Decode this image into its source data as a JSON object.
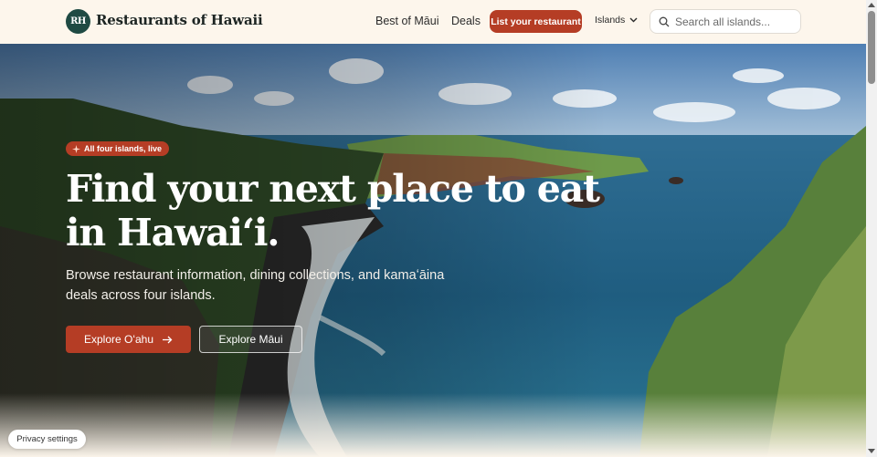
{
  "brand": {
    "mark": "RH",
    "name": "Restaurants of Hawaii"
  },
  "nav": {
    "best_of": "Best of Māui",
    "deals": "Deals",
    "list_restaurant": "List your restaurant",
    "islands": "Islands"
  },
  "search": {
    "placeholder": "Search all islands..."
  },
  "hero": {
    "badge": "All four islands, live",
    "headline": "Find your next place to eat in Hawaiʻi.",
    "subtext": "Browse restaurant information, dining collections, and kamaʻāina deals across four islands.",
    "primary_cta": "Explore Oʻahu",
    "secondary_cta": "Explore Māui"
  },
  "privacy": "Privacy settings",
  "colors": {
    "accent": "#b53d25",
    "brand_dark": "#1f4a43",
    "header_bg": "#fdf6ec"
  },
  "icons": [
    "search-icon",
    "chevron-down-icon",
    "sparkle-icon",
    "arrow-right-icon"
  ]
}
